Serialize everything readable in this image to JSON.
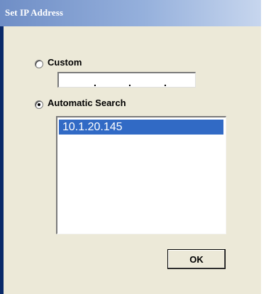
{
  "window": {
    "title": "Set IP Address"
  },
  "custom": {
    "label": "Custom",
    "selected": false,
    "ip_separators": [
      ".",
      ".",
      "."
    ]
  },
  "automatic": {
    "label": "Automatic Search",
    "selected": true,
    "results": [
      {
        "address": "10.1.20.145",
        "selected": true
      }
    ]
  },
  "buttons": {
    "ok_label": "OK"
  },
  "colors": {
    "title_gradient_start": "#6f8ec6",
    "title_gradient_end": "#c7d6ee",
    "selection": "#316ac5",
    "dialog_bg": "#ece9d8"
  }
}
